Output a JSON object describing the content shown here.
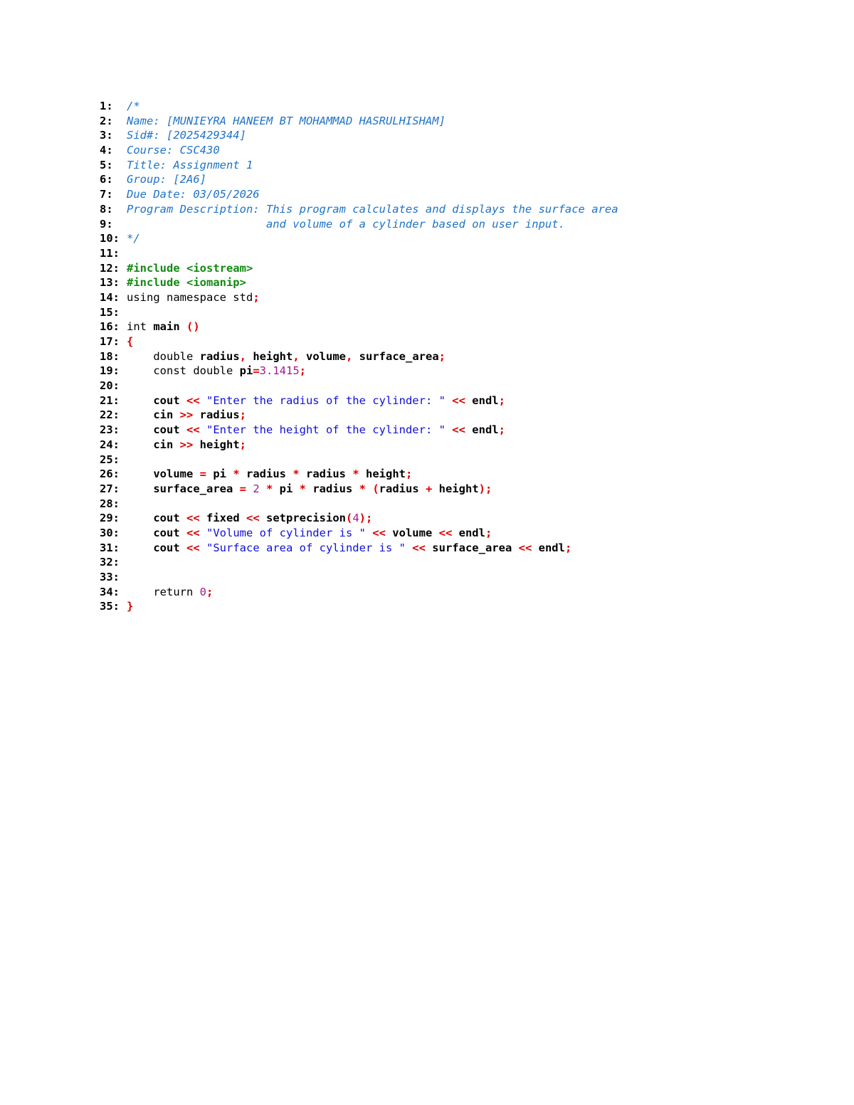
{
  "colors": {
    "comment": "#1e73c8",
    "preprocessor": "#128a12",
    "operator": "#e00000",
    "string": "#1010d8",
    "number": "#a01890",
    "text": "#000000"
  },
  "code": {
    "lines": [
      {
        "num": "1:",
        "tokens": [
          {
            "t": "/*",
            "k": "cm"
          }
        ]
      },
      {
        "num": "2:",
        "tokens": [
          {
            "t": "Name: [MUNIEYRA HANEEM BT MOHAMMAD HASRULHISHAM]",
            "k": "cm"
          }
        ]
      },
      {
        "num": "3:",
        "tokens": [
          {
            "t": "Sid#: [2025429344]",
            "k": "cm"
          }
        ]
      },
      {
        "num": "4:",
        "tokens": [
          {
            "t": "Course: CSC430",
            "k": "cm"
          }
        ]
      },
      {
        "num": "5:",
        "tokens": [
          {
            "t": "Title: Assignment 1",
            "k": "cm"
          }
        ]
      },
      {
        "num": "6:",
        "tokens": [
          {
            "t": "Group: [2A6]",
            "k": "cm"
          }
        ]
      },
      {
        "num": "7:",
        "tokens": [
          {
            "t": "Due Date: 03/05/2026",
            "k": "cm"
          }
        ]
      },
      {
        "num": "8:",
        "tokens": [
          {
            "t": "Program Description: This program calculates and displays the surface area",
            "k": "cm"
          }
        ]
      },
      {
        "num": "9:",
        "tokens": [
          {
            "t": "                     and volume of a cylinder based on user input.",
            "k": "cm"
          }
        ]
      },
      {
        "num": "10:",
        "tokens": [
          {
            "t": "*/",
            "k": "cm"
          }
        ]
      },
      {
        "num": "11:",
        "tokens": []
      },
      {
        "num": "12:",
        "tokens": [
          {
            "t": "#include <iostream>",
            "k": "pp"
          }
        ]
      },
      {
        "num": "13:",
        "tokens": [
          {
            "t": "#include <iomanip>",
            "k": "pp"
          }
        ]
      },
      {
        "num": "14:",
        "tokens": [
          {
            "t": "using namespace std",
            "k": "kw"
          },
          {
            "t": ";",
            "k": "op"
          }
        ]
      },
      {
        "num": "15:",
        "tokens": []
      },
      {
        "num": "16:",
        "tokens": [
          {
            "t": "int ",
            "k": "kw"
          },
          {
            "t": "main ",
            "k": "id"
          },
          {
            "t": "()",
            "k": "op"
          }
        ]
      },
      {
        "num": "17:",
        "tokens": [
          {
            "t": "{",
            "k": "op"
          }
        ]
      },
      {
        "num": "18:",
        "tokens": [
          {
            "t": "    double ",
            "k": "kw"
          },
          {
            "t": "radius",
            "k": "id"
          },
          {
            "t": ", ",
            "k": "op"
          },
          {
            "t": "height",
            "k": "id"
          },
          {
            "t": ", ",
            "k": "op"
          },
          {
            "t": "volume",
            "k": "id"
          },
          {
            "t": ", ",
            "k": "op"
          },
          {
            "t": "surface_area",
            "k": "id"
          },
          {
            "t": ";",
            "k": "op"
          }
        ]
      },
      {
        "num": "19:",
        "tokens": [
          {
            "t": "    const double ",
            "k": "kw"
          },
          {
            "t": "pi",
            "k": "id"
          },
          {
            "t": "=",
            "k": "op"
          },
          {
            "t": "3.1415",
            "k": "num"
          },
          {
            "t": ";",
            "k": "op"
          }
        ]
      },
      {
        "num": "20:",
        "tokens": []
      },
      {
        "num": "21:",
        "tokens": [
          {
            "t": "    cout ",
            "k": "id"
          },
          {
            "t": "<< ",
            "k": "op"
          },
          {
            "t": "\"Enter the radius of the cylinder: \" ",
            "k": "str"
          },
          {
            "t": "<< ",
            "k": "op"
          },
          {
            "t": "endl",
            "k": "id"
          },
          {
            "t": ";",
            "k": "op"
          }
        ]
      },
      {
        "num": "22:",
        "tokens": [
          {
            "t": "    cin ",
            "k": "id"
          },
          {
            "t": ">> ",
            "k": "op"
          },
          {
            "t": "radius",
            "k": "id"
          },
          {
            "t": ";",
            "k": "op"
          }
        ]
      },
      {
        "num": "23:",
        "tokens": [
          {
            "t": "    cout ",
            "k": "id"
          },
          {
            "t": "<< ",
            "k": "op"
          },
          {
            "t": "\"Enter the height of the cylinder: \" ",
            "k": "str"
          },
          {
            "t": "<< ",
            "k": "op"
          },
          {
            "t": "endl",
            "k": "id"
          },
          {
            "t": ";",
            "k": "op"
          }
        ]
      },
      {
        "num": "24:",
        "tokens": [
          {
            "t": "    cin ",
            "k": "id"
          },
          {
            "t": ">> ",
            "k": "op"
          },
          {
            "t": "height",
            "k": "id"
          },
          {
            "t": ";",
            "k": "op"
          }
        ]
      },
      {
        "num": "25:",
        "tokens": []
      },
      {
        "num": "26:",
        "tokens": [
          {
            "t": "    volume ",
            "k": "id"
          },
          {
            "t": "= ",
            "k": "op"
          },
          {
            "t": "pi ",
            "k": "id"
          },
          {
            "t": "* ",
            "k": "op"
          },
          {
            "t": "radius ",
            "k": "id"
          },
          {
            "t": "* ",
            "k": "op"
          },
          {
            "t": "radius ",
            "k": "id"
          },
          {
            "t": "* ",
            "k": "op"
          },
          {
            "t": "height",
            "k": "id"
          },
          {
            "t": ";",
            "k": "op"
          }
        ]
      },
      {
        "num": "27:",
        "tokens": [
          {
            "t": "    surface_area ",
            "k": "id"
          },
          {
            "t": "= ",
            "k": "op"
          },
          {
            "t": "2 ",
            "k": "num"
          },
          {
            "t": "* ",
            "k": "op"
          },
          {
            "t": "pi ",
            "k": "id"
          },
          {
            "t": "* ",
            "k": "op"
          },
          {
            "t": "radius ",
            "k": "id"
          },
          {
            "t": "* (",
            "k": "op"
          },
          {
            "t": "radius ",
            "k": "id"
          },
          {
            "t": "+ ",
            "k": "op"
          },
          {
            "t": "height",
            "k": "id"
          },
          {
            "t": ");",
            "k": "op"
          }
        ]
      },
      {
        "num": "28:",
        "tokens": []
      },
      {
        "num": "29:",
        "tokens": [
          {
            "t": "    cout ",
            "k": "id"
          },
          {
            "t": "<< ",
            "k": "op"
          },
          {
            "t": "fixed ",
            "k": "id"
          },
          {
            "t": "<< ",
            "k": "op"
          },
          {
            "t": "setprecision",
            "k": "id"
          },
          {
            "t": "(",
            "k": "op"
          },
          {
            "t": "4",
            "k": "num"
          },
          {
            "t": ");",
            "k": "op"
          }
        ]
      },
      {
        "num": "30:",
        "tokens": [
          {
            "t": "    cout ",
            "k": "id"
          },
          {
            "t": "<< ",
            "k": "op"
          },
          {
            "t": "\"Volume of cylinder is \" ",
            "k": "str"
          },
          {
            "t": "<< ",
            "k": "op"
          },
          {
            "t": "volume ",
            "k": "id"
          },
          {
            "t": "<< ",
            "k": "op"
          },
          {
            "t": "endl",
            "k": "id"
          },
          {
            "t": ";",
            "k": "op"
          }
        ]
      },
      {
        "num": "31:",
        "tokens": [
          {
            "t": "    cout ",
            "k": "id"
          },
          {
            "t": "<< ",
            "k": "op"
          },
          {
            "t": "\"Surface area of cylinder is \" ",
            "k": "str"
          },
          {
            "t": "<< ",
            "k": "op"
          },
          {
            "t": "surface_area ",
            "k": "id"
          },
          {
            "t": "<< ",
            "k": "op"
          },
          {
            "t": "endl",
            "k": "id"
          },
          {
            "t": ";",
            "k": "op"
          }
        ]
      },
      {
        "num": "32:",
        "tokens": []
      },
      {
        "num": "33:",
        "tokens": []
      },
      {
        "num": "34:",
        "tokens": [
          {
            "t": "    return ",
            "k": "kw"
          },
          {
            "t": "0",
            "k": "num"
          },
          {
            "t": ";",
            "k": "op"
          }
        ]
      },
      {
        "num": "35:",
        "tokens": [
          {
            "t": "}",
            "k": "op"
          }
        ]
      }
    ]
  }
}
